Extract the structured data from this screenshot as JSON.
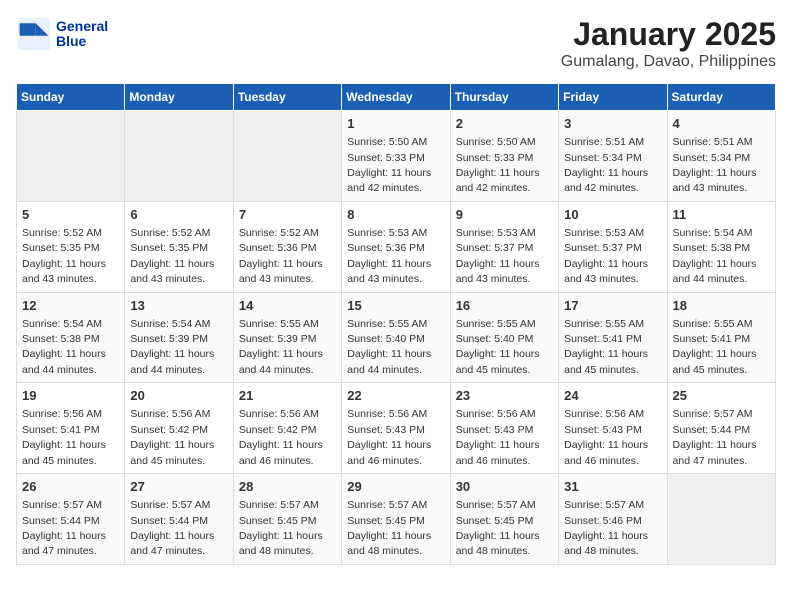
{
  "logo": {
    "line1": "General",
    "line2": "Blue"
  },
  "title": "January 2025",
  "subtitle": "Gumalang, Davao, Philippines",
  "headers": [
    "Sunday",
    "Monday",
    "Tuesday",
    "Wednesday",
    "Thursday",
    "Friday",
    "Saturday"
  ],
  "weeks": [
    [
      {
        "day": "",
        "info": ""
      },
      {
        "day": "",
        "info": ""
      },
      {
        "day": "",
        "info": ""
      },
      {
        "day": "1",
        "info": "Sunrise: 5:50 AM\nSunset: 5:33 PM\nDaylight: 11 hours\nand 42 minutes."
      },
      {
        "day": "2",
        "info": "Sunrise: 5:50 AM\nSunset: 5:33 PM\nDaylight: 11 hours\nand 42 minutes."
      },
      {
        "day": "3",
        "info": "Sunrise: 5:51 AM\nSunset: 5:34 PM\nDaylight: 11 hours\nand 42 minutes."
      },
      {
        "day": "4",
        "info": "Sunrise: 5:51 AM\nSunset: 5:34 PM\nDaylight: 11 hours\nand 43 minutes."
      }
    ],
    [
      {
        "day": "5",
        "info": "Sunrise: 5:52 AM\nSunset: 5:35 PM\nDaylight: 11 hours\nand 43 minutes."
      },
      {
        "day": "6",
        "info": "Sunrise: 5:52 AM\nSunset: 5:35 PM\nDaylight: 11 hours\nand 43 minutes."
      },
      {
        "day": "7",
        "info": "Sunrise: 5:52 AM\nSunset: 5:36 PM\nDaylight: 11 hours\nand 43 minutes."
      },
      {
        "day": "8",
        "info": "Sunrise: 5:53 AM\nSunset: 5:36 PM\nDaylight: 11 hours\nand 43 minutes."
      },
      {
        "day": "9",
        "info": "Sunrise: 5:53 AM\nSunset: 5:37 PM\nDaylight: 11 hours\nand 43 minutes."
      },
      {
        "day": "10",
        "info": "Sunrise: 5:53 AM\nSunset: 5:37 PM\nDaylight: 11 hours\nand 43 minutes."
      },
      {
        "day": "11",
        "info": "Sunrise: 5:54 AM\nSunset: 5:38 PM\nDaylight: 11 hours\nand 44 minutes."
      }
    ],
    [
      {
        "day": "12",
        "info": "Sunrise: 5:54 AM\nSunset: 5:38 PM\nDaylight: 11 hours\nand 44 minutes."
      },
      {
        "day": "13",
        "info": "Sunrise: 5:54 AM\nSunset: 5:39 PM\nDaylight: 11 hours\nand 44 minutes."
      },
      {
        "day": "14",
        "info": "Sunrise: 5:55 AM\nSunset: 5:39 PM\nDaylight: 11 hours\nand 44 minutes."
      },
      {
        "day": "15",
        "info": "Sunrise: 5:55 AM\nSunset: 5:40 PM\nDaylight: 11 hours\nand 44 minutes."
      },
      {
        "day": "16",
        "info": "Sunrise: 5:55 AM\nSunset: 5:40 PM\nDaylight: 11 hours\nand 45 minutes."
      },
      {
        "day": "17",
        "info": "Sunrise: 5:55 AM\nSunset: 5:41 PM\nDaylight: 11 hours\nand 45 minutes."
      },
      {
        "day": "18",
        "info": "Sunrise: 5:55 AM\nSunset: 5:41 PM\nDaylight: 11 hours\nand 45 minutes."
      }
    ],
    [
      {
        "day": "19",
        "info": "Sunrise: 5:56 AM\nSunset: 5:41 PM\nDaylight: 11 hours\nand 45 minutes."
      },
      {
        "day": "20",
        "info": "Sunrise: 5:56 AM\nSunset: 5:42 PM\nDaylight: 11 hours\nand 45 minutes."
      },
      {
        "day": "21",
        "info": "Sunrise: 5:56 AM\nSunset: 5:42 PM\nDaylight: 11 hours\nand 46 minutes."
      },
      {
        "day": "22",
        "info": "Sunrise: 5:56 AM\nSunset: 5:43 PM\nDaylight: 11 hours\nand 46 minutes."
      },
      {
        "day": "23",
        "info": "Sunrise: 5:56 AM\nSunset: 5:43 PM\nDaylight: 11 hours\nand 46 minutes."
      },
      {
        "day": "24",
        "info": "Sunrise: 5:56 AM\nSunset: 5:43 PM\nDaylight: 11 hours\nand 46 minutes."
      },
      {
        "day": "25",
        "info": "Sunrise: 5:57 AM\nSunset: 5:44 PM\nDaylight: 11 hours\nand 47 minutes."
      }
    ],
    [
      {
        "day": "26",
        "info": "Sunrise: 5:57 AM\nSunset: 5:44 PM\nDaylight: 11 hours\nand 47 minutes."
      },
      {
        "day": "27",
        "info": "Sunrise: 5:57 AM\nSunset: 5:44 PM\nDaylight: 11 hours\nand 47 minutes."
      },
      {
        "day": "28",
        "info": "Sunrise: 5:57 AM\nSunset: 5:45 PM\nDaylight: 11 hours\nand 48 minutes."
      },
      {
        "day": "29",
        "info": "Sunrise: 5:57 AM\nSunset: 5:45 PM\nDaylight: 11 hours\nand 48 minutes."
      },
      {
        "day": "30",
        "info": "Sunrise: 5:57 AM\nSunset: 5:45 PM\nDaylight: 11 hours\nand 48 minutes."
      },
      {
        "day": "31",
        "info": "Sunrise: 5:57 AM\nSunset: 5:46 PM\nDaylight: 11 hours\nand 48 minutes."
      },
      {
        "day": "",
        "info": ""
      }
    ]
  ]
}
